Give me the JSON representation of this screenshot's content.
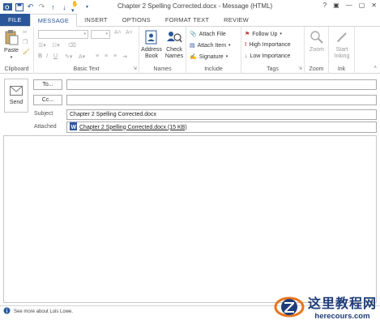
{
  "window": {
    "title": "Chapter 2 Spelling Corrected.docx - Message (HTML)",
    "controls": [
      "?",
      "▣",
      "—",
      "▢",
      "✕"
    ]
  },
  "tabs": [
    "FILE",
    "MESSAGE",
    "INSERT",
    "OPTIONS",
    "FORMAT TEXT",
    "REVIEW"
  ],
  "ribbon": {
    "clipboard": {
      "label": "Clipboard",
      "paste": "Paste"
    },
    "basic_text": {
      "label": "Basic Text"
    },
    "names": {
      "label": "Names",
      "address_book_1": "Address",
      "address_book_2": "Book",
      "check_names_1": "Check",
      "check_names_2": "Names"
    },
    "include": {
      "label": "Include",
      "attach_file": "Attach File",
      "attach_item": "Attach Item",
      "signature": "Signature"
    },
    "tags": {
      "label": "Tags",
      "follow_up": "Follow Up",
      "high_importance": "High Importance",
      "low_importance": "Low Importance"
    },
    "zoom": {
      "label": "Zoom",
      "zoom": "Zoom"
    },
    "ink": {
      "label": "Ink",
      "start_inking_1": "Start",
      "start_inking_2": "Inking"
    }
  },
  "compose": {
    "send": "Send",
    "to_button": "To...",
    "cc_button": "Cc...",
    "to_value": "",
    "cc_value": "",
    "subject_label": "Subject",
    "subject_value": "Chapter 2 Spelling Corrected.docx",
    "attached_label": "Attached",
    "attachment": "Chapter 2 Spelling Corrected.docx (15 KB)"
  },
  "people_bar": {
    "text": "See more about Lois Lowe."
  },
  "watermark": {
    "cn": "这里教程网",
    "url": "herecours.com"
  },
  "colors": {
    "accent": "#2b579a",
    "watermark": "#1e3c78",
    "follow_up_flag": "#d13438",
    "high_importance": "#d13438",
    "low_importance": "#2b579a"
  }
}
